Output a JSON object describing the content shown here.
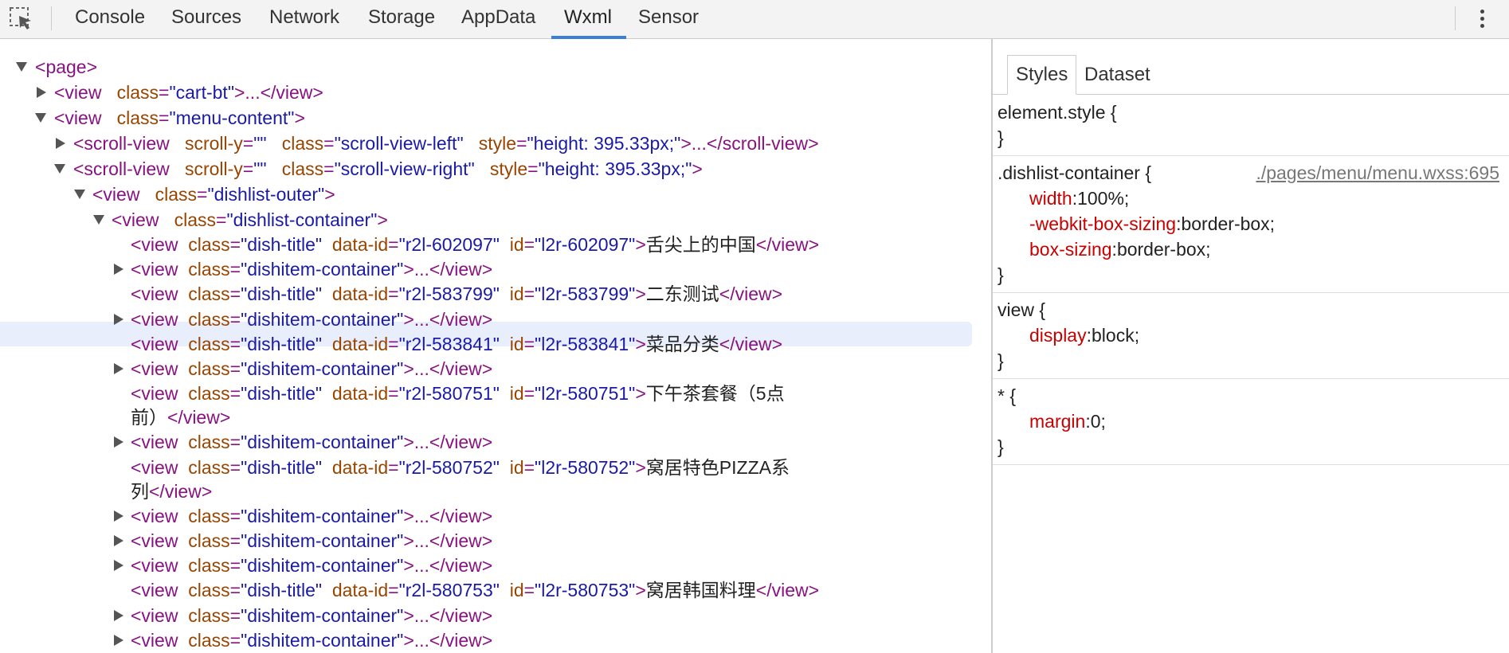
{
  "toolbar": {
    "tabs": [
      "Console",
      "Sources",
      "Network",
      "Storage",
      "AppData",
      "Wxml",
      "Sensor"
    ],
    "active_tab": "Wxml",
    "accent": "#3b7fd9"
  },
  "tree": {
    "r0": {
      "open": "<",
      "tag": "page",
      "close": ">"
    },
    "r1": {
      "tag": "<view",
      "a1": "class",
      "v1": "\"cart-bt\"",
      "rest": ">...</view>"
    },
    "r2": {
      "tag": "<view",
      "a1": "class",
      "v1": "\"menu-content\"",
      "rest": ">"
    },
    "r3": {
      "tag": "<scroll-view",
      "a1": "scroll-y",
      "v1": "\"\"",
      "a2": "class",
      "v2": "\"scroll-view-left\"",
      "a3": "style",
      "v3": "\"height: 395.33px;\"",
      "rest": ">...</scroll-view>"
    },
    "r4": {
      "tag": "<scroll-view",
      "a1": "scroll-y",
      "v1": "\"\"",
      "a2": "class",
      "v2": "\"scroll-view-right\"",
      "a3": "style",
      "v3": "\"height: 395.33px;\"",
      "rest": ">"
    },
    "r5": {
      "tag": "<view",
      "a1": "class",
      "v1": "\"dishlist-outer\"",
      "rest": ">"
    },
    "r6": {
      "tag": "<view",
      "a1": "class",
      "v1": "\"dishlist-container\"",
      "rest": ">"
    },
    "items": [
      {
        "type": "title",
        "dataid": "\"r2l-602097\"",
        "id": "\"l2r-602097\"",
        "text": "舌尖上的中国",
        "text2": ""
      },
      {
        "type": "container"
      },
      {
        "type": "title",
        "dataid": "\"r2l-583799\"",
        "id": "\"l2r-583799\"",
        "text": "二东测试",
        "text2": ""
      },
      {
        "type": "container"
      },
      {
        "type": "title",
        "dataid": "\"r2l-583841\"",
        "id": "\"l2r-583841\"",
        "text": "菜品分类",
        "text2": ""
      },
      {
        "type": "container"
      },
      {
        "type": "title",
        "dataid": "\"r2l-580751\"",
        "id": "\"l2r-580751\"",
        "text": "下午茶套餐（5点",
        "text2": "前）"
      },
      {
        "type": "container"
      },
      {
        "type": "title",
        "dataid": "\"r2l-580752\"",
        "id": "\"l2r-580752\"",
        "text": "窝居特色PIZZA系",
        "text2": "列"
      },
      {
        "type": "container"
      },
      {
        "type": "container"
      },
      {
        "type": "container"
      },
      {
        "type": "title",
        "dataid": "\"r2l-580753\"",
        "id": "\"l2r-580753\"",
        "text": "窝居韩国料理",
        "text2": ""
      },
      {
        "type": "container"
      },
      {
        "type": "container"
      }
    ],
    "labels": {
      "view": "<view",
      "class": "class",
      "dish_title": "\"dish-title\"",
      "data_id": "data-id",
      "id": "id",
      "dishitem": "\"dishitem-container\"",
      "ellipsis": ">...</view>",
      "gt": ">",
      "end_view": "</view>"
    }
  },
  "styles_panel": {
    "tabs": [
      "Styles",
      "Dataset"
    ],
    "active_tab": "Styles",
    "rules": [
      {
        "selector": "element.style {",
        "source": "",
        "props": [],
        "close": "}"
      },
      {
        "selector": ".dishlist-container {",
        "source": "./pages/menu/menu.wxss:695",
        "props": [
          {
            "name": "width",
            "value": "100%;"
          },
          {
            "name": "-webkit-box-sizing",
            "value": "border-box;"
          },
          {
            "name": "box-sizing",
            "value": "border-box;"
          }
        ],
        "close": "}"
      },
      {
        "selector": "view {",
        "source": "",
        "props": [
          {
            "name": "display",
            "value": "block;"
          }
        ],
        "close": "}"
      },
      {
        "selector": "* {",
        "source": "",
        "props": [
          {
            "name": "margin",
            "value": "0;"
          }
        ],
        "close": "}"
      }
    ]
  }
}
